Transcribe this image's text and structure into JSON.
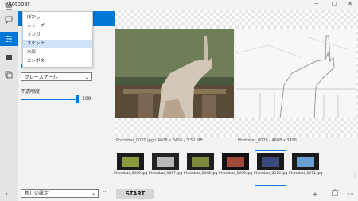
{
  "app": {
    "title": "Photobat"
  },
  "window": {
    "minimize": "─",
    "maximize": "☐",
    "close": "✕"
  },
  "effect_dropdown": {
    "items": [
      "ぼかし",
      "シャープ",
      "マンガ",
      "スケッチ",
      "水彩",
      "エンボス"
    ],
    "selected": "スケッチ"
  },
  "panel": {
    "color_mode_value": "グレースケール",
    "opacity_label": "不透明度：",
    "opacity_value": "100",
    "opacity_level_percent": 100
  },
  "preset": {
    "value": "新しい設定",
    "more_label": "···"
  },
  "preview": {
    "caption": "Photobat_0070.jpg / 4608 x 3456 / 2.52 MB",
    "caption_right": "Photobat_0070 / 4608 x 3456"
  },
  "filmstrip": {
    "thumbnails": [
      {
        "label": "Photobat_0066.jpg"
      },
      {
        "label": "Photobat_0067.jpg"
      },
      {
        "label": "Photobat_0068.jpg"
      },
      {
        "label": "Photobat_0069.jpg"
      },
      {
        "label": "Photobat_0070.jpg",
        "selected": true
      },
      {
        "label": "Photobat_0071.jpg"
      }
    ]
  },
  "bottom_bar": {
    "start_label": "START",
    "add_icon": "+",
    "delete_icon": "🗑",
    "more_icon": "···",
    "left_arrow": "›"
  },
  "colors": {
    "accent": "#0078d7",
    "panel": "#f2f2f2",
    "rail": "#e4e4e4"
  }
}
